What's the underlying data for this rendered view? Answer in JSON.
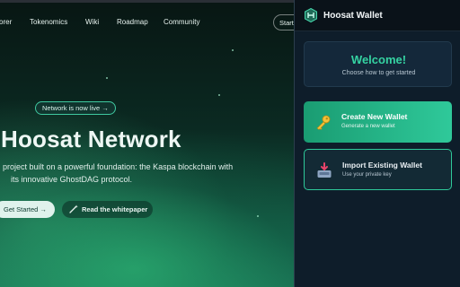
{
  "site": {
    "nav": [
      "orer",
      "Tokenomics",
      "Wiki",
      "Roadmap",
      "Community"
    ],
    "start_label": "Start",
    "live_badge": "Network is now live →",
    "title": "Hoosat Network",
    "subtitle_line1": "project built on a powerful foundation: the Kaspa blockchain with",
    "subtitle_line2": "its innovative GhostDAG protocol.",
    "get_started": "Get Started →",
    "whitepaper": "Read the whitepaper"
  },
  "wallet": {
    "title": "Hoosat Wallet",
    "welcome_title": "Welcome!",
    "welcome_sub": "Choose how to get started",
    "create_title": "Create New Wallet",
    "create_sub": "Generate a new wallet",
    "import_title": "Import Existing Wallet",
    "import_sub": "Use your private key"
  },
  "colors": {
    "accent": "#2fc99a",
    "wallet_bg": "#0e1d2a",
    "site_glow": "#1c7a5a"
  }
}
